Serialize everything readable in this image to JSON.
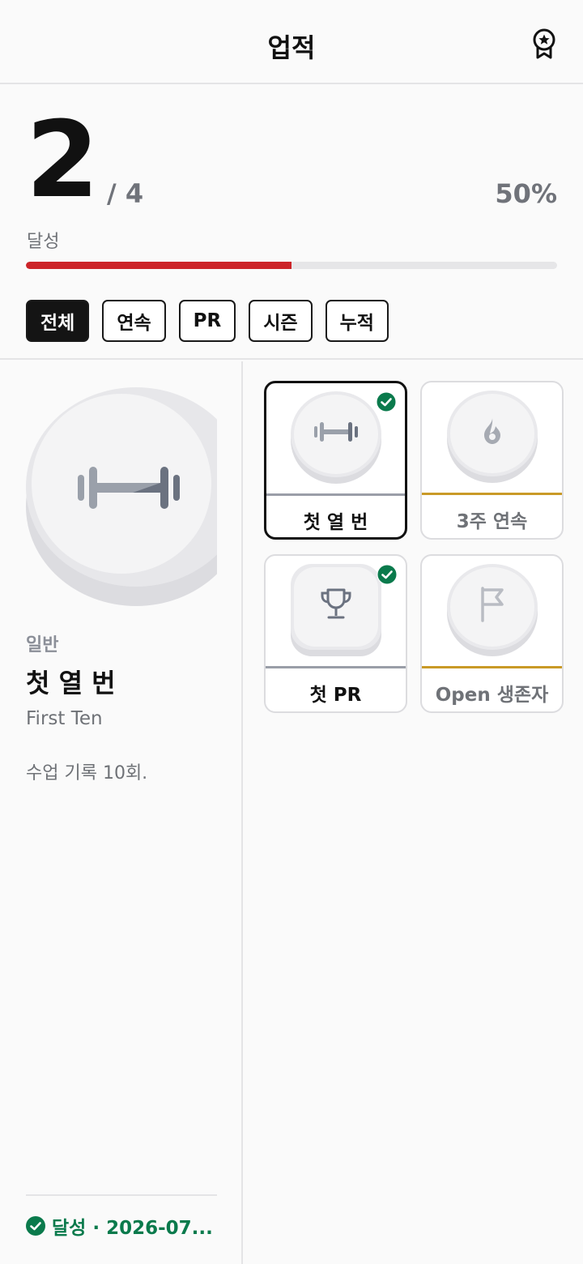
{
  "header": {
    "title": "업적",
    "icon": "award-ribbon-icon"
  },
  "summary": {
    "achieved": "2",
    "total": "/ 4",
    "percent_label": "50%",
    "progress_fraction": 0.5,
    "label": "달성",
    "accent": "#cc2429"
  },
  "filters": [
    {
      "label": "전체",
      "active": true
    },
    {
      "label": "연속",
      "active": false
    },
    {
      "label": "PR",
      "active": false
    },
    {
      "label": "시즌",
      "active": false
    },
    {
      "label": "누적",
      "active": false
    }
  ],
  "detail": {
    "icon": "barbell-icon",
    "category": "일반",
    "title": "첫 열 번",
    "subtitle": "First Ten",
    "description": "수업 기록 10회.",
    "status": "달성 · 2026-07...",
    "status_color": "#0a7a4c"
  },
  "achievements": [
    {
      "name": "첫 열 번",
      "icon": "barbell-icon",
      "achieved": true,
      "selected": true,
      "tier_color": "#9a9ea8"
    },
    {
      "name": "3주 연속",
      "icon": "flame-icon",
      "achieved": false,
      "selected": false,
      "tier_color": "#c99a27"
    },
    {
      "name": "첫 PR",
      "icon": "trophy-icon",
      "achieved": true,
      "selected": false,
      "tier_color": "#9a9ea8"
    },
    {
      "name": "Open 생존자",
      "icon": "flag-icon",
      "achieved": false,
      "selected": false,
      "tier_color": "#c99a27"
    }
  ]
}
